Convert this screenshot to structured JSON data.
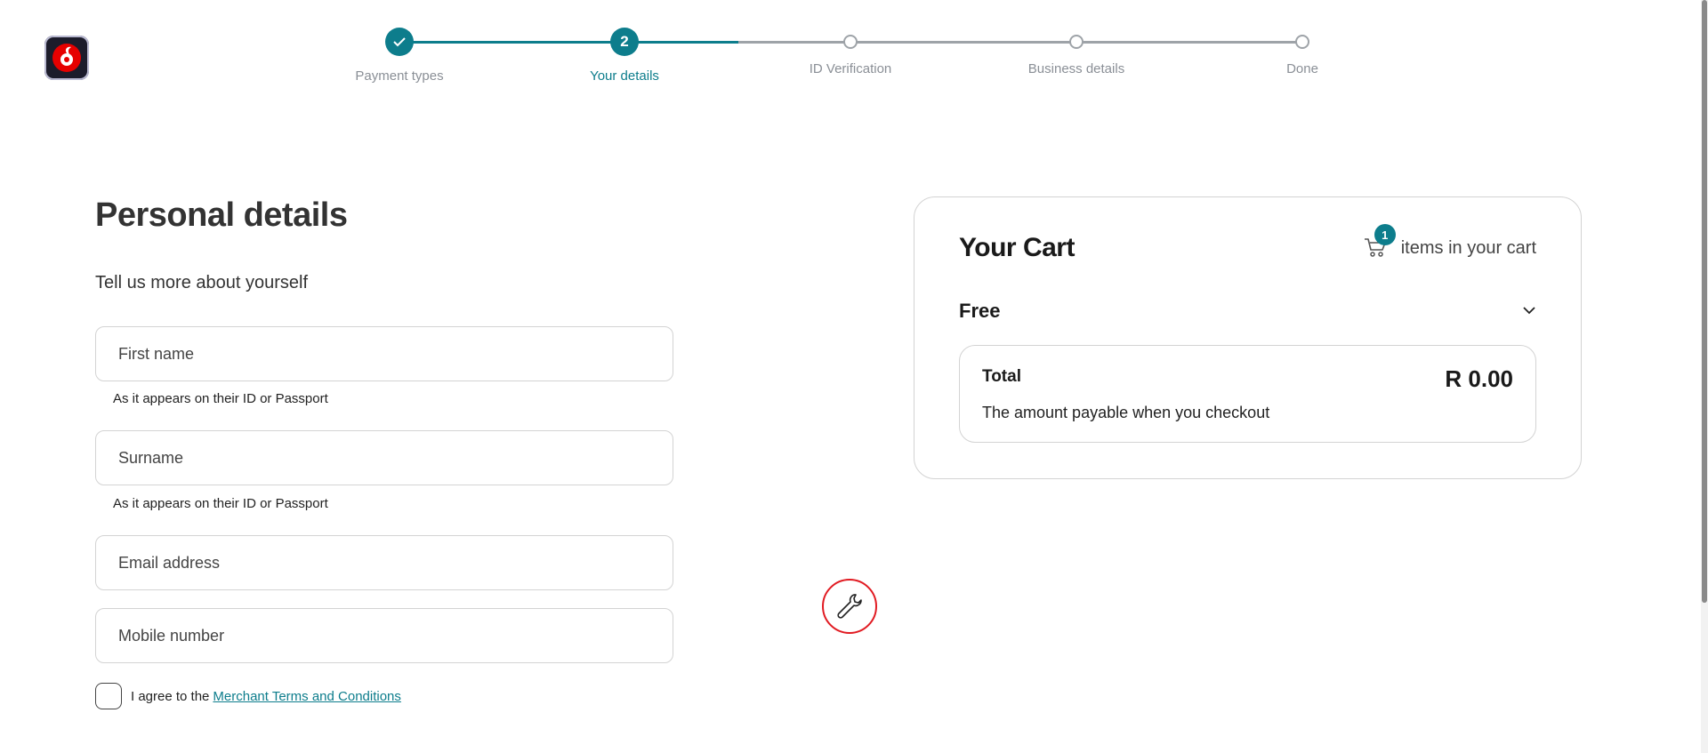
{
  "brand": {
    "logo_icon": "vodafone-logo-icon",
    "accent": "#0d7d8c",
    "brand_red": "#e60000"
  },
  "stepper": {
    "steps": [
      {
        "label": "Payment types",
        "marker": "",
        "state": "done"
      },
      {
        "label": "Your details",
        "marker": "2",
        "state": "active"
      },
      {
        "label": "ID Verification",
        "marker": "",
        "state": "todo"
      },
      {
        "label": "Business details",
        "marker": "",
        "state": "todo"
      },
      {
        "label": "Done",
        "marker": "",
        "state": "todo"
      }
    ]
  },
  "form": {
    "title": "Personal details",
    "subtitle": "Tell us more about yourself",
    "first_name": {
      "placeholder": "First name",
      "value": ""
    },
    "first_name_hint": "As it appears on their ID or Passport",
    "surname": {
      "placeholder": "Surname",
      "value": ""
    },
    "surname_hint": "As it appears on their ID or Passport",
    "email": {
      "placeholder": "Email address",
      "value": ""
    },
    "mobile": {
      "placeholder": "Mobile number",
      "value": ""
    },
    "agree_text": "I agree to the",
    "terms_link": "Merchant Terms and Conditions"
  },
  "tools": {
    "icon": "wrench-icon",
    "color": "#e11b22"
  },
  "cart": {
    "title": "Your Cart",
    "count": "1",
    "count_label": "items in your cart",
    "plan": "Free",
    "total_label": "Total",
    "total_value": "R 0.00",
    "total_note": "The amount payable when you checkout"
  }
}
